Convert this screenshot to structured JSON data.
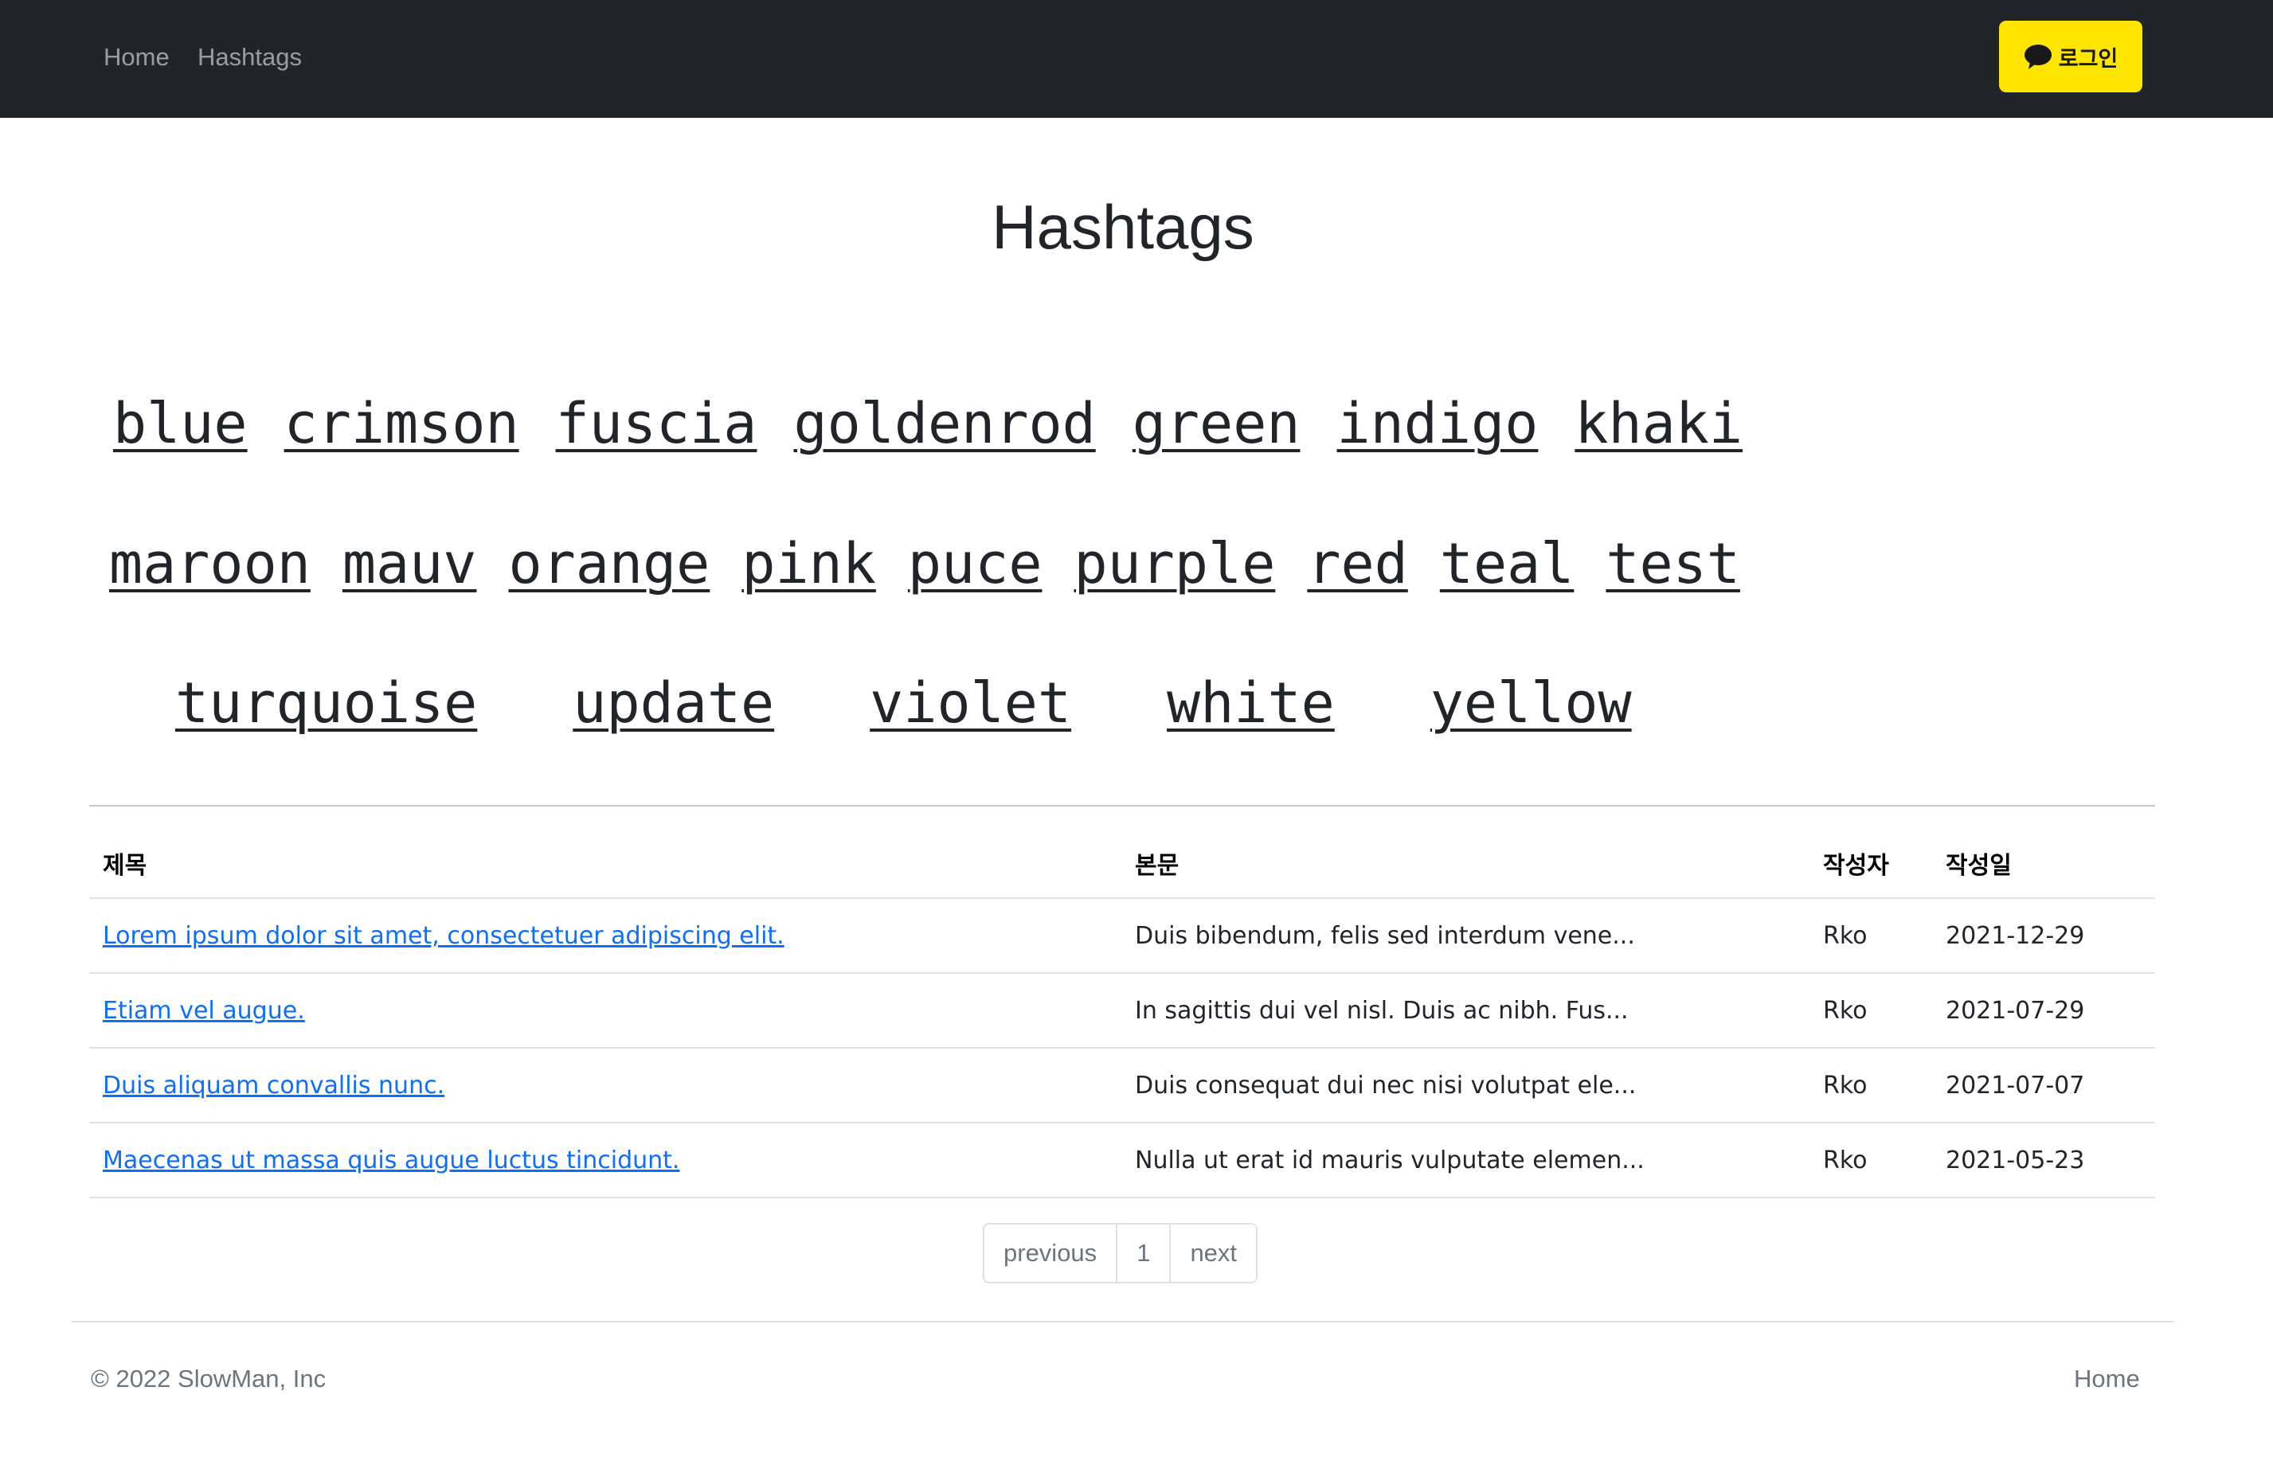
{
  "navbar": {
    "links": [
      "Home",
      "Hashtags"
    ],
    "login_label": "로그인",
    "login_color": "#FEE500",
    "login_icon": "speech-bubble-icon"
  },
  "page": {
    "title": "Hashtags"
  },
  "hashtags": {
    "row1": [
      "blue",
      "crimson",
      "fuscia",
      "goldenrod",
      "green",
      "indigo",
      "khaki"
    ],
    "row2": [
      "maroon",
      "mauv",
      "orange",
      "pink",
      "puce",
      "purple",
      "red",
      "teal",
      "test"
    ],
    "row3": [
      "turquoise",
      "update",
      "violet",
      "white",
      "yellow"
    ]
  },
  "table": {
    "headers": [
      "제목",
      "본문",
      "작성자",
      "작성일"
    ],
    "rows": [
      {
        "title": "Lorem ipsum dolor sit amet, consectetuer adipiscing elit.",
        "body": "Duis bibendum, felis sed interdum vene...",
        "author": "Rko",
        "date": "2021-12-29"
      },
      {
        "title": "Etiam vel augue.",
        "body": "In sagittis dui vel nisl. Duis ac nibh. Fus...",
        "author": "Rko",
        "date": "2021-07-29"
      },
      {
        "title": "Duis aliquam convallis nunc.",
        "body": "Duis consequat dui nec nisi volutpat ele...",
        "author": "Rko",
        "date": "2021-07-07"
      },
      {
        "title": "Maecenas ut massa quis augue luctus tincidunt.",
        "body": "Nulla ut erat id mauris vulputate elemen...",
        "author": "Rko",
        "date": "2021-05-23"
      }
    ]
  },
  "pagination": {
    "previous": "previous",
    "page": "1",
    "next": "next"
  },
  "footer": {
    "copyright": "© 2022 SlowMan, Inc",
    "home": "Home"
  }
}
